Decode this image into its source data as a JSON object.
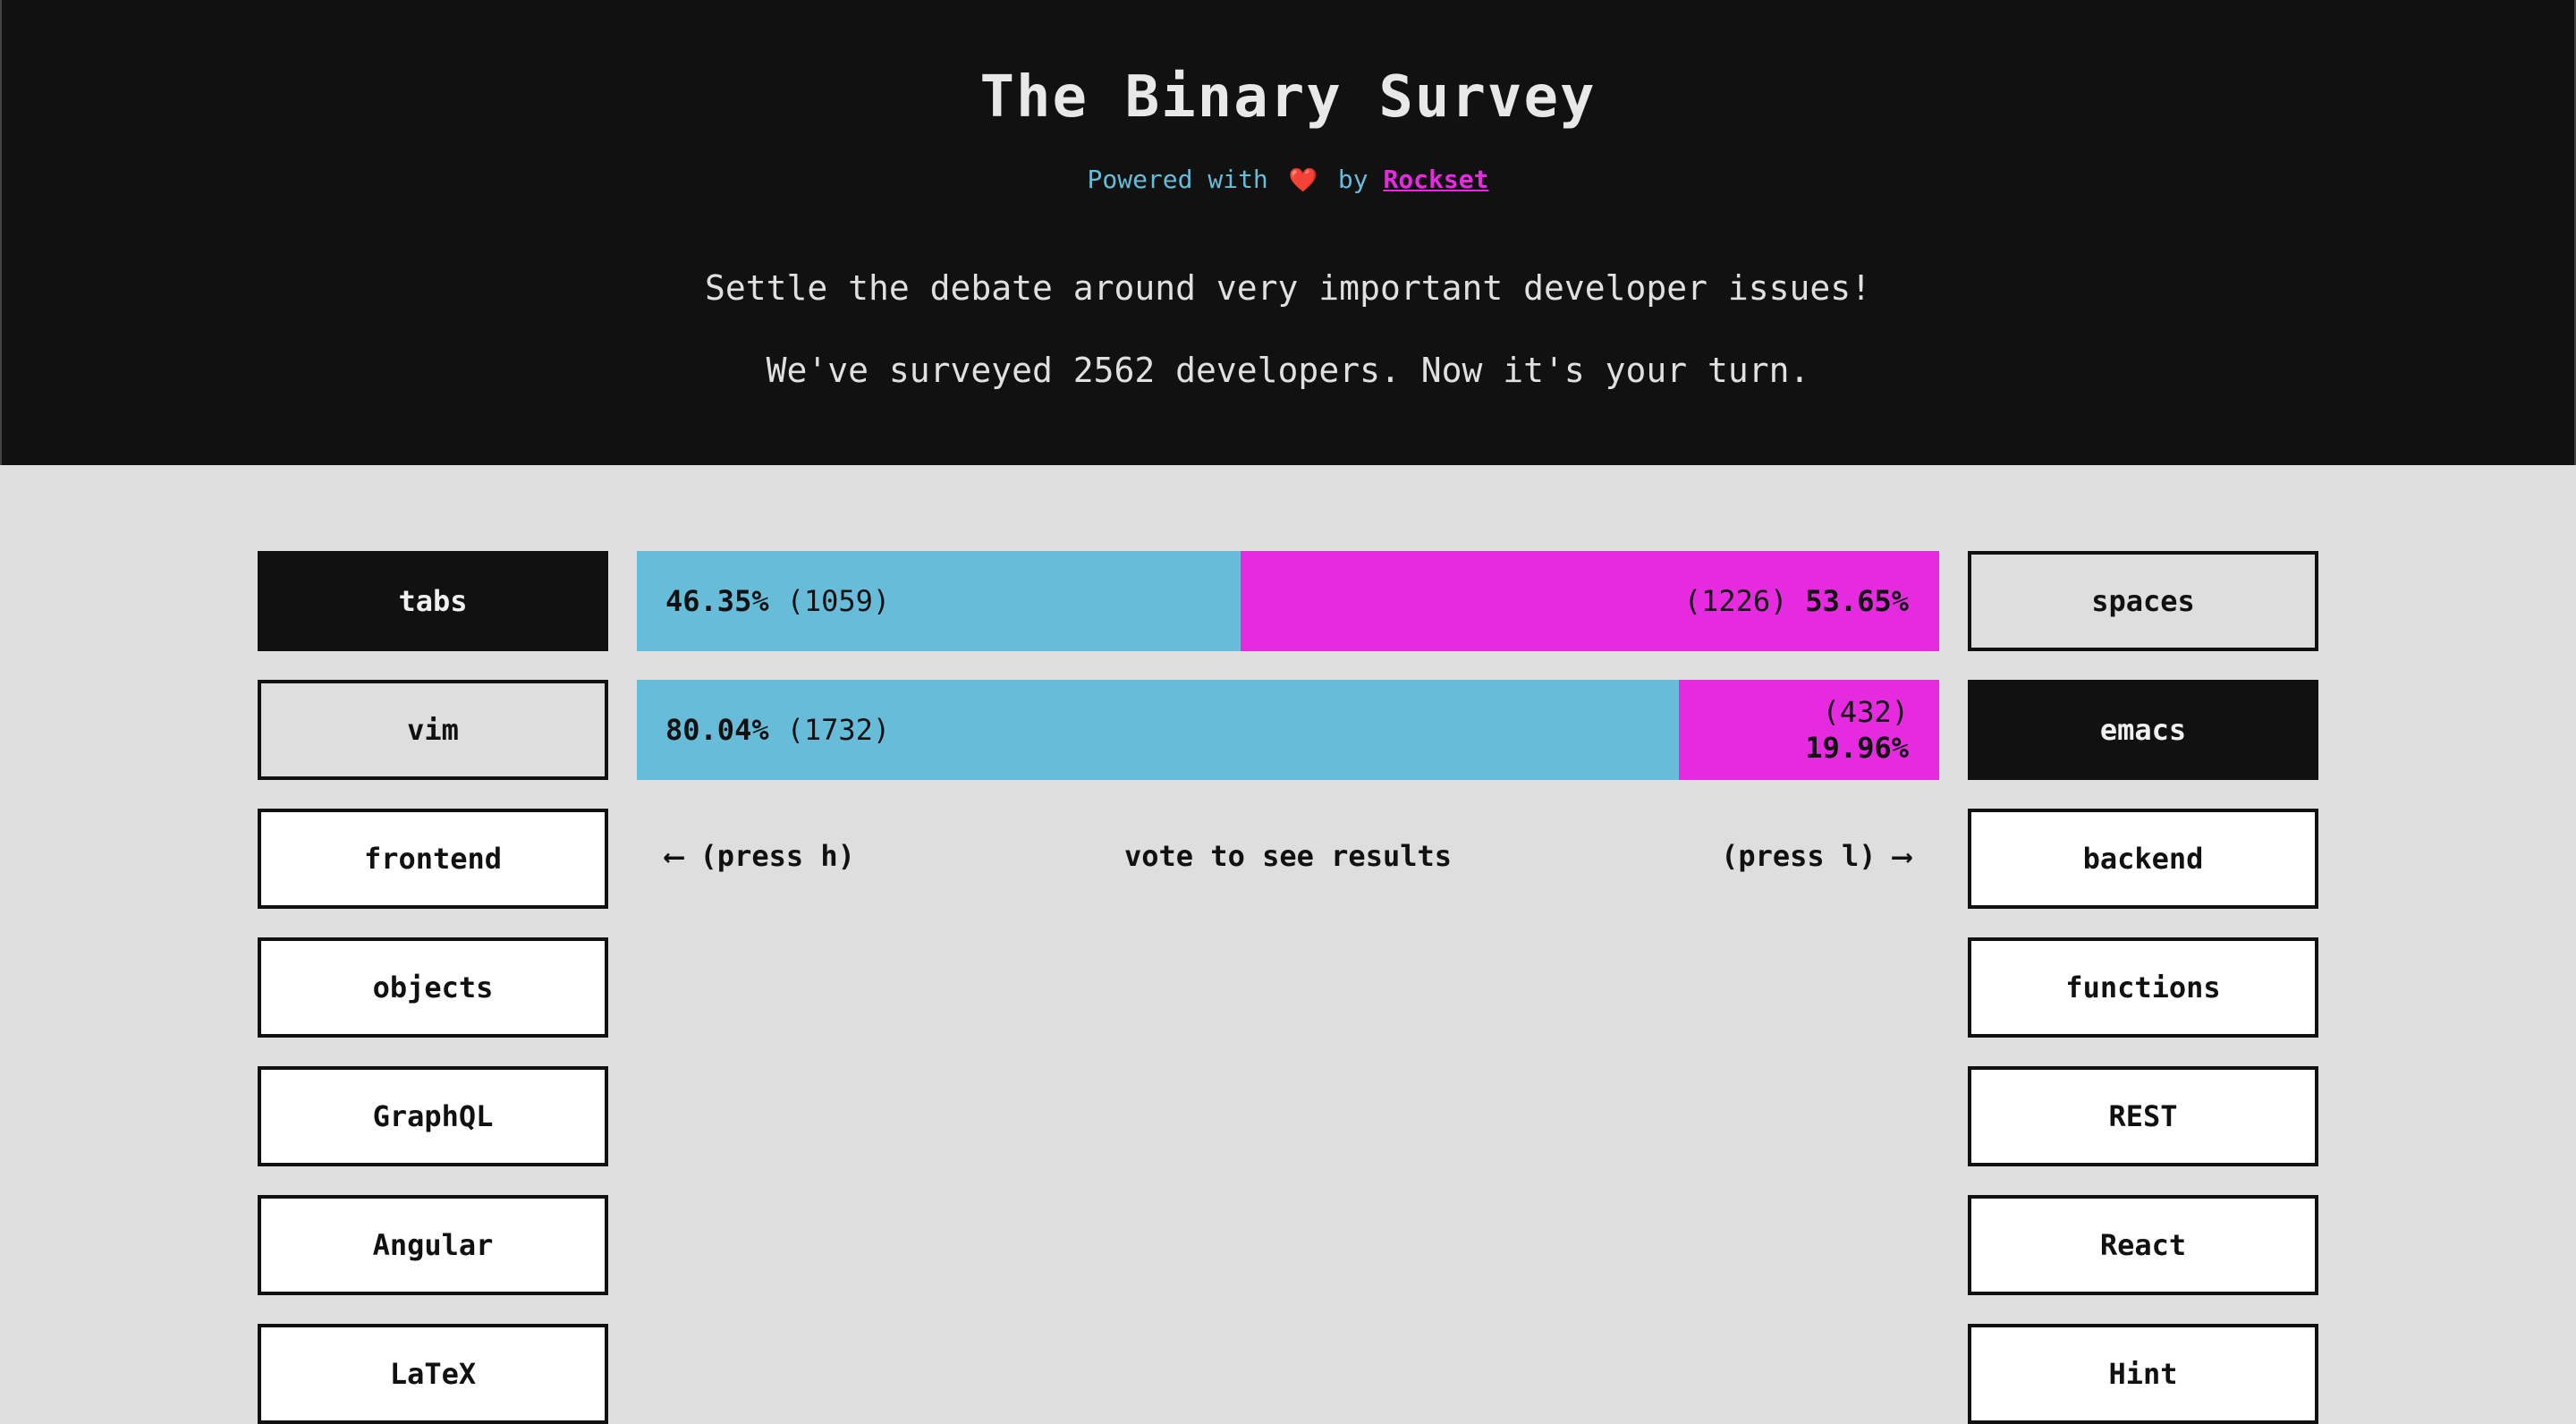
{
  "header": {
    "title": "The Binary Survey",
    "powered_prefix": "Powered with",
    "heart": "❤️",
    "powered_by": "by",
    "link_text": "Rockset",
    "intro_line1": "Settle the debate around very important developer issues!",
    "intro_line2": "We've surveyed 2562 developers. Now it's your turn."
  },
  "colors": {
    "header_bg": "#111111",
    "page_bg": "#dedede",
    "left_bar": "#67bdd9",
    "right_bar": "#e62ae0",
    "link": "#e62ae0"
  },
  "questions": [
    {
      "left": "tabs",
      "right": "spaces",
      "selected": "left",
      "left_pct_value": 46.35,
      "left_pct": "46.35%",
      "left_count": "(1059)",
      "right_pct": "53.65%",
      "right_count": "(1226)"
    },
    {
      "left": "vim",
      "right": "emacs",
      "selected": "right",
      "left_pct_value": 80.04,
      "left_pct": "80.04%",
      "left_count": "(1732)",
      "right_pct": "19.96%",
      "right_count": "(432)"
    },
    {
      "left": "frontend",
      "right": "backend"
    },
    {
      "left": "objects",
      "right": "functions"
    },
    {
      "left": "GraphQL",
      "right": "REST"
    },
    {
      "left": "Angular",
      "right": "React"
    },
    {
      "left": "LaTeX",
      "right": "Hint"
    }
  ],
  "hints": {
    "left": "⟵ (press h)",
    "center": "vote to see results",
    "right": "(press l) ⟶"
  }
}
